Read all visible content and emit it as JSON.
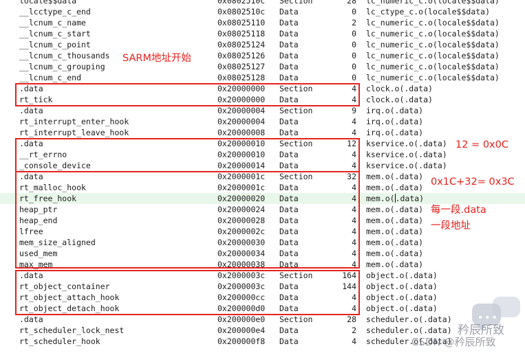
{
  "rows": [
    {
      "sym": "locale$$data",
      "addr": "0x0802510c",
      "type": "Section",
      "size": "28",
      "obj": "lc_numeric_c.o(locale$$data)"
    },
    {
      "sym": "__lcctype_c_end",
      "addr": "0x0802510c",
      "type": "Data",
      "size": "0",
      "obj": "lc_ctype_c.o(locale$$data)"
    },
    {
      "sym": "__lcnum_c_name",
      "addr": "0x08025110",
      "type": "Data",
      "size": "2",
      "obj": "lc_numeric_c.o(locale$$data)"
    },
    {
      "sym": "__lcnum_c_start",
      "addr": "0x08025118",
      "type": "Data",
      "size": "0",
      "obj": "lc_numeric_c.o(locale$$data)"
    },
    {
      "sym": "__lcnum_c_point",
      "addr": "0x08025124",
      "type": "Data",
      "size": "0",
      "obj": "lc_numeric_c.o(locale$$data)"
    },
    {
      "sym": "__lcnum_c_thousands",
      "addr": "0x08025126",
      "type": "Data",
      "size": "0",
      "obj": "lc_numeric_c.o(locale$$data)"
    },
    {
      "sym": "__lcnum_c_grouping",
      "addr": "0x08025127",
      "type": "Data",
      "size": "0",
      "obj": "lc_numeric_c.o(locale$$data)"
    },
    {
      "sym": "__lcnum_c_end",
      "addr": "0x08025128",
      "type": "Data",
      "size": "0",
      "obj": "lc_numeric_c.o(locale$$data)"
    },
    {
      "sym": ".data",
      "addr": "0x20000000",
      "type": "Section",
      "size": "4",
      "obj": "clock.o(.data)"
    },
    {
      "sym": "rt_tick",
      "addr": "0x20000000",
      "type": "Data",
      "size": "4",
      "obj": "clock.o(.data)"
    },
    {
      "sym": ".data",
      "addr": "0x20000004",
      "type": "Section",
      "size": "9",
      "obj": "irq.o(.data)"
    },
    {
      "sym": "rt_interrupt_enter_hook",
      "addr": "0x20000004",
      "type": "Data",
      "size": "4",
      "obj": "irq.o(.data)"
    },
    {
      "sym": "rt_interrupt_leave_hook",
      "addr": "0x20000008",
      "type": "Data",
      "size": "4",
      "obj": "irq.o(.data)"
    },
    {
      "sym": ".data",
      "addr": "0x20000010",
      "type": "Section",
      "size": "12",
      "obj": "kservice.o(.data)"
    },
    {
      "sym": "__rt_errno",
      "addr": "0x20000010",
      "type": "Data",
      "size": "4",
      "obj": "kservice.o(.data)"
    },
    {
      "sym": "_console_device",
      "addr": "0x20000014",
      "type": "Data",
      "size": "4",
      "obj": "kservice.o(.data)"
    },
    {
      "sym": ".data",
      "addr": "0x2000001c",
      "type": "Section",
      "size": "32",
      "obj": "mem.o(.data)"
    },
    {
      "sym": "rt_malloc_hook",
      "addr": "0x2000001c",
      "type": "Data",
      "size": "4",
      "obj": "mem.o(.data)"
    },
    {
      "sym": "rt_free_hook",
      "addr": "0x20000020",
      "type": "Data",
      "size": "4",
      "obj": "mem.o(.data)",
      "highlight": true
    },
    {
      "sym": "heap_ptr",
      "addr": "0x20000024",
      "type": "Data",
      "size": "4",
      "obj": "mem.o(.data)"
    },
    {
      "sym": "heap_end",
      "addr": "0x20000028",
      "type": "Data",
      "size": "4",
      "obj": "mem.o(.data)"
    },
    {
      "sym": "lfree",
      "addr": "0x2000002c",
      "type": "Data",
      "size": "4",
      "obj": "mem.o(.data)"
    },
    {
      "sym": "mem_size_aligned",
      "addr": "0x20000030",
      "type": "Data",
      "size": "4",
      "obj": "mem.o(.data)"
    },
    {
      "sym": "used_mem",
      "addr": "0x20000034",
      "type": "Data",
      "size": "4",
      "obj": "mem.o(.data)"
    },
    {
      "sym": "max_mem",
      "addr": "0x20000038",
      "type": "Data",
      "size": "4",
      "obj": "mem.o(.data)"
    },
    {
      "sym": ".data",
      "addr": "0x2000003c",
      "type": "Section",
      "size": "164",
      "obj": "object.o(.data)"
    },
    {
      "sym": "rt_object_container",
      "addr": "0x2000003c",
      "type": "Data",
      "size": "144",
      "obj": "object.o(.data)"
    },
    {
      "sym": "rt_object_attach_hook",
      "addr": "0x200000cc",
      "type": "Data",
      "size": "4",
      "obj": "object.o(.data)"
    },
    {
      "sym": "rt_object_detach_hook",
      "addr": "0x200000d0",
      "type": "Data",
      "size": "4",
      "obj": "object.o(.data)"
    },
    {
      "sym": ".data",
      "addr": "0x200000e0",
      "type": "Section",
      "size": "28",
      "obj": "scheduler.o(.data)"
    },
    {
      "sym": "rt_scheduler_lock_nest",
      "addr": "0x200000e4",
      "type": "Data",
      "size": "2",
      "obj": "scheduler.o(.data)"
    },
    {
      "sym": "rt_scheduler_hook",
      "addr": "0x200000f8",
      "type": "Data",
      "size": "4",
      "obj": "scheduler.o(.data)"
    }
  ],
  "annotations": {
    "sram_start": "SARM地址开始",
    "kservice_size": "12 = 0x0C",
    "mem_calc": "0x1C+32= 0x3C",
    "segment_line1": "每一段.data",
    "segment_line2": "一段地址"
  },
  "watermark": {
    "account": "矜辰所致",
    "footer": "CSDN @矜辰所致"
  },
  "colors": {
    "annotation_red": "#e5211d",
    "highlight_row": "#e9f7ea",
    "text": "#1a1a1a"
  }
}
